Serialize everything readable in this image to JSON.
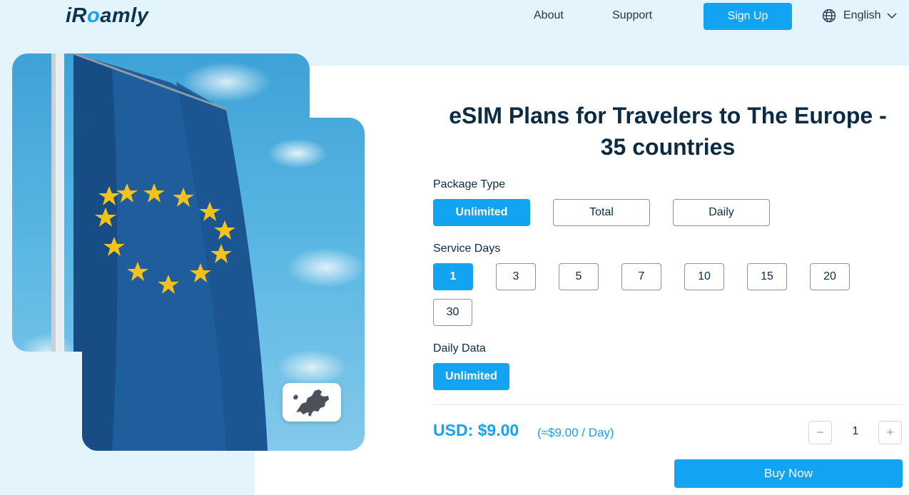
{
  "header": {
    "logo": {
      "prefix": "iR",
      "accent": "o",
      "suffix": "amly"
    },
    "nav": {
      "about": "About",
      "support": "Support"
    },
    "signup_label": "Sign Up",
    "language": "English"
  },
  "plan": {
    "title_line1": "eSIM Plans for Travelers to The Europe -",
    "title_line2": "35 countries",
    "package_type": {
      "label": "Package Type",
      "options": [
        "Unlimited",
        "Total",
        "Daily"
      ],
      "selected": "Unlimited"
    },
    "service_days": {
      "label": "Service Days",
      "options": [
        "1",
        "3",
        "5",
        "7",
        "10",
        "15",
        "20",
        "30"
      ],
      "selected": "1"
    },
    "daily_data": {
      "label": "Daily Data",
      "options": [
        "Unlimited"
      ],
      "selected": "Unlimited"
    },
    "price": "USD: $9.00",
    "price_per_day": "(≈$9.00 / Day)",
    "quantity": "1",
    "minus_symbol": "−",
    "plus_symbol": "+",
    "buy_label": "Buy Now"
  },
  "colors": {
    "accent": "#12a4f3",
    "page_bg": "#e3f4fc",
    "text_dark": "#0b2b45"
  },
  "icons": {
    "language": "globe-icon",
    "dropdown": "chevron-down-icon",
    "map": "europe-map-icon",
    "flag": "eu-flag-image"
  }
}
